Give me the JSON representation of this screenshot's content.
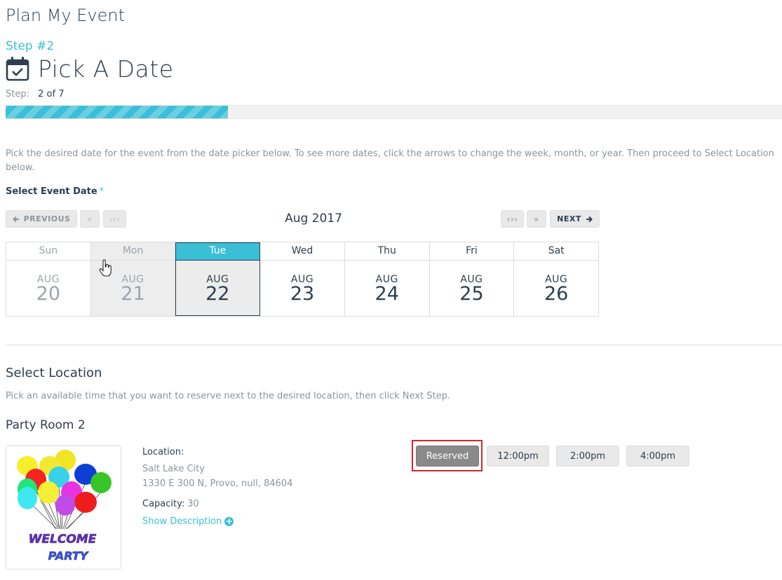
{
  "app_title": "Plan My Event",
  "step_heading": {
    "number": "Step #2",
    "title": "Pick A Date",
    "icon": "calendar-check-icon"
  },
  "progress": {
    "label": "Step:",
    "value": "2 of 7",
    "current": 2,
    "total": 7,
    "fraction": 0.286
  },
  "instructions": "Pick the desired date for the event from the date picker below. To see more dates, click the arrows to change the week, month, or year. Then proceed to Select Location below.",
  "date_field": {
    "label": "Select Event Date",
    "required_mark": "*"
  },
  "calendar": {
    "prev_label": "PREVIOUS",
    "prev_month_glyph": "«",
    "prev_year_glyph": "‹‹‹",
    "next_year_glyph": "›››",
    "next_month_glyph": "»",
    "next_label": "NEXT",
    "month_label": "Aug 2017",
    "days": [
      {
        "name": "Sun",
        "month": "AUG",
        "day": "20",
        "state": "past"
      },
      {
        "name": "Mon",
        "month": "AUG",
        "day": "21",
        "state": "past-hover"
      },
      {
        "name": "Tue",
        "month": "AUG",
        "day": "22",
        "state": "selected"
      },
      {
        "name": "Wed",
        "month": "AUG",
        "day": "23",
        "state": "available"
      },
      {
        "name": "Thu",
        "month": "AUG",
        "day": "24",
        "state": "available"
      },
      {
        "name": "Fri",
        "month": "AUG",
        "day": "25",
        "state": "available"
      },
      {
        "name": "Sat",
        "month": "AUG",
        "day": "26",
        "state": "available"
      }
    ]
  },
  "location_section": {
    "title": "Select Location",
    "subtitle": "Pick an available time that you want to reserve next to the desired location, then click Next Step."
  },
  "room": {
    "name": "Party Room 2",
    "image_text_1": "WELCOME",
    "image_text_2": "PARTY",
    "location_label": "Location:",
    "city": "Salt Lake City",
    "address": "1330 E 300 N, Provo, null, 84604",
    "capacity_label": "Capacity:",
    "capacity_value": "30",
    "show_description": "Show Description",
    "show_description_icon": "plus-circle-icon"
  },
  "time_slots": [
    {
      "label": "Reserved",
      "state": "reserved"
    },
    {
      "label": "12:00pm",
      "state": "available"
    },
    {
      "label": "2:00pm",
      "state": "available"
    },
    {
      "label": "4:00pm",
      "state": "available"
    }
  ],
  "colors": {
    "accent": "#3bbfd6",
    "text": "#2d3e50",
    "muted": "#8a959e",
    "reserved": "#8a8a8a",
    "highlight": "#d9252b"
  }
}
